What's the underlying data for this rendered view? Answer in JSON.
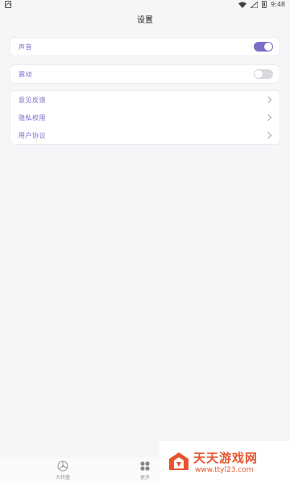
{
  "status_bar": {
    "time": "9:48"
  },
  "header": {
    "title": "设置"
  },
  "settings": {
    "sound": {
      "label": "声音",
      "enabled": true
    },
    "vibration": {
      "label": "震动",
      "enabled": false
    },
    "links": [
      {
        "label": "意见反馈"
      },
      {
        "label": "隐私权限"
      },
      {
        "label": "用户协议"
      }
    ]
  },
  "bottom_nav": {
    "items": [
      {
        "label": "大转盘",
        "icon": "wheel-icon"
      },
      {
        "label": "更多",
        "icon": "grid-icon"
      }
    ]
  },
  "watermark": {
    "title": "天天游戏网",
    "url": "www.ttyl23.com"
  },
  "colors": {
    "accent": "#7b6cc8",
    "watermark": "#e8542c"
  }
}
